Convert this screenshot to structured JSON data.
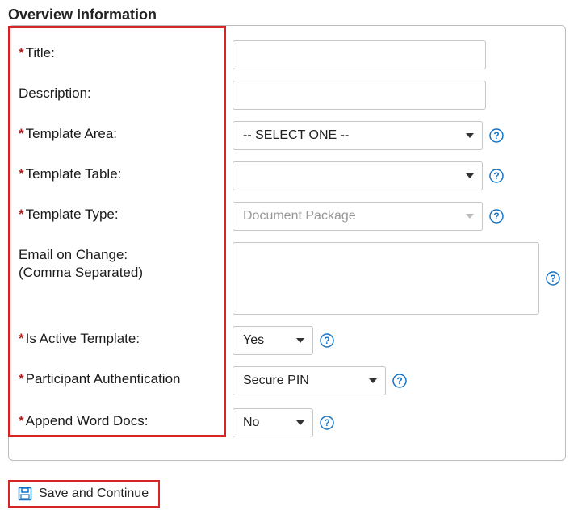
{
  "heading": "Overview Information",
  "labels": {
    "title": "Title:",
    "description": "Description:",
    "templateArea": "Template Area:",
    "templateTable": "Template Table:",
    "templateType": "Template Type:",
    "emailOnChange": "Email on Change:",
    "emailOnChangeSub": "(Comma Separated)",
    "isActive": "Is Active Template:",
    "participantAuth": "Participant Authentication",
    "appendWord": "Append Word Docs:"
  },
  "values": {
    "title": "",
    "description": "",
    "templateArea": "-- SELECT ONE --",
    "templateTable": "",
    "templateType": "Document Package",
    "emailOnChange": "",
    "isActive": "Yes",
    "participantAuth": "Secure PIN",
    "appendWord": "No"
  },
  "buttons": {
    "saveContinue": "Save and Continue"
  }
}
